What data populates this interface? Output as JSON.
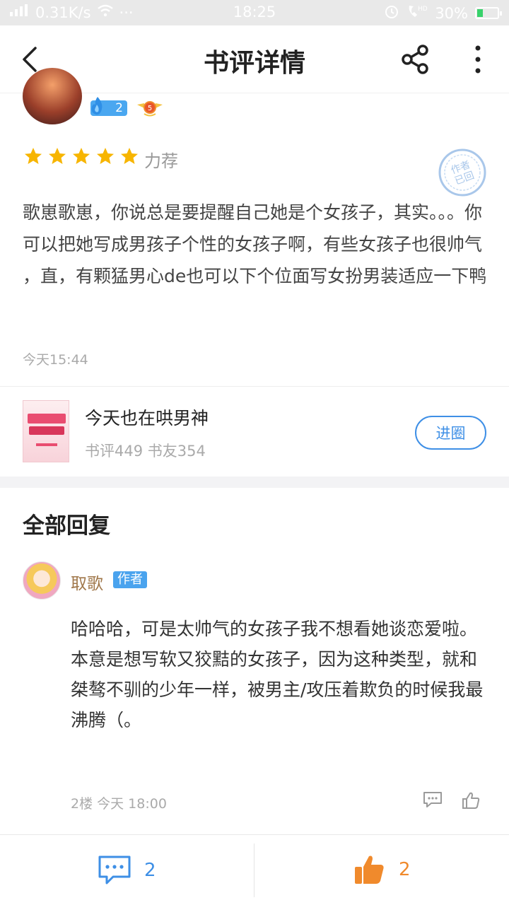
{
  "status_bar": {
    "network": "0.31K/s",
    "time": "18:25",
    "battery": "30%",
    "battery_level": 0.3
  },
  "nav": {
    "title": "书评详情",
    "back_icon": "chevron-left-icon",
    "share_icon": "share-icon",
    "more_icon": "more-vertical-icon"
  },
  "review": {
    "fire_level": "2",
    "user_level": "5",
    "stars": 5,
    "rating_label": "力荐",
    "stamp_text": "作者已回",
    "text": "歌崽歌崽，你说总是要提醒自己她是个女孩子，其实。。。你可以把她写成男孩子个性的女孩子啊，有些女孩子也很帅气 ，直，有颗猛男心de也可以下个位面写女扮男装适应一下鸭",
    "time": "今天15:44"
  },
  "book": {
    "title": "今天也在哄男神",
    "stats": "书评449 书友354",
    "join_label": "进圈"
  },
  "replies": {
    "section_title": "全部回复",
    "items": [
      {
        "user": "取歌",
        "tag": "作者",
        "text": "哈哈哈，可是太帅气的女孩子我不想看她谈恋爱啦。\n本意是想写软又狡黠的女孩子，因为这种类型，就和桀骜不驯的少年一样，被男主/攻压着欺负的时候我最沸腾（。",
        "meta": "2楼 今天 18:00"
      }
    ]
  },
  "bottom_bar": {
    "comment_count": "2",
    "like_count": "2"
  },
  "colors": {
    "accent_blue": "#3e8fe6",
    "like_orange": "#f08a2c",
    "star_yellow": "#f7b500"
  }
}
